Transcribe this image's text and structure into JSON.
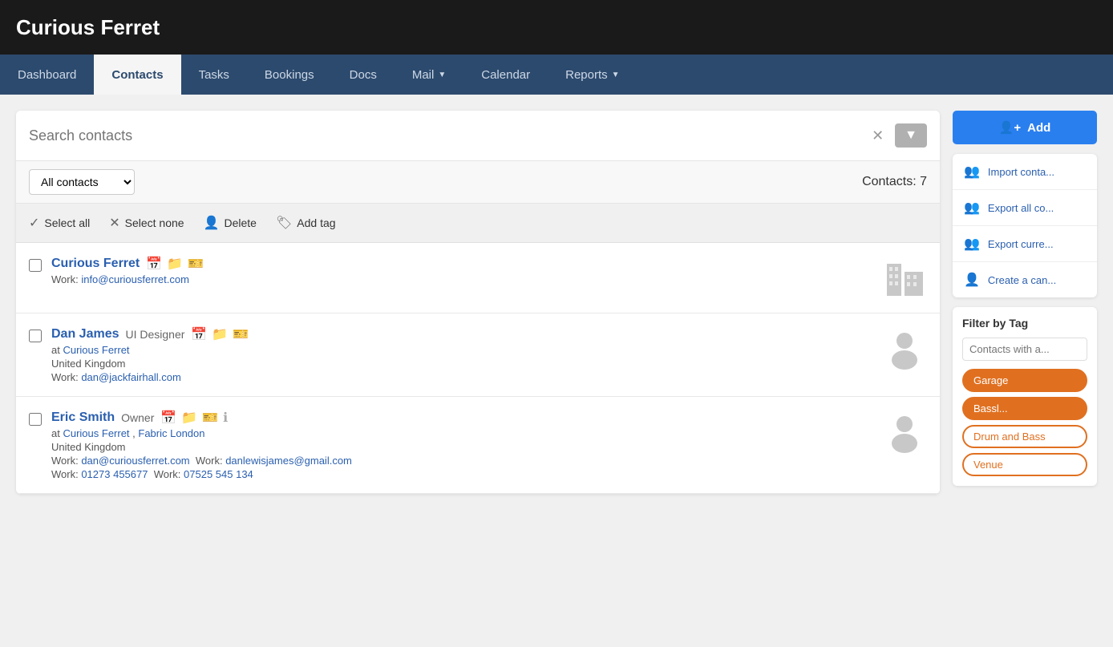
{
  "app": {
    "title": "Curious Ferret"
  },
  "nav": {
    "items": [
      {
        "id": "dashboard",
        "label": "Dashboard",
        "active": false,
        "dropdown": false
      },
      {
        "id": "contacts",
        "label": "Contacts",
        "active": true,
        "dropdown": false
      },
      {
        "id": "tasks",
        "label": "Tasks",
        "active": false,
        "dropdown": false
      },
      {
        "id": "bookings",
        "label": "Bookings",
        "active": false,
        "dropdown": false
      },
      {
        "id": "docs",
        "label": "Docs",
        "active": false,
        "dropdown": false
      },
      {
        "id": "mail",
        "label": "Mail",
        "active": false,
        "dropdown": true
      },
      {
        "id": "calendar",
        "label": "Calendar",
        "active": false,
        "dropdown": false
      },
      {
        "id": "reports",
        "label": "Reports",
        "active": false,
        "dropdown": true
      }
    ]
  },
  "search": {
    "placeholder": "Search contacts",
    "value": ""
  },
  "contacts": {
    "filter_label": "All contacts",
    "count_label": "Contacts: 7",
    "actions": {
      "select_all": "Select all",
      "select_none": "Select none",
      "delete": "Delete",
      "add_tag": "Add tag"
    },
    "items": [
      {
        "id": "curious-ferret-org",
        "name": "Curious Ferret",
        "role": "",
        "type": "organization",
        "at_company": "",
        "country": "",
        "work_email": "info@curiousferret.com",
        "work_email2": "",
        "work_email3": "",
        "work_phone": "",
        "work_phone2": ""
      },
      {
        "id": "dan-james",
        "name": "Dan James",
        "role": "UI Designer",
        "type": "person",
        "at_company": "Curious Ferret",
        "country": "United Kingdom",
        "work_email": "dan@jackfairhall.com",
        "work_email2": "",
        "work_email3": "",
        "work_phone": "",
        "work_phone2": ""
      },
      {
        "id": "eric-smith",
        "name": "Eric Smith",
        "role": "Owner",
        "type": "person",
        "at_company": "Curious Ferret",
        "at_company2": "Fabric London",
        "country": "United Kingdom",
        "work_email": "dan@curiousferret.com",
        "work_email2": "danlewisjames@gmail.com",
        "work_phone": "01273 455677",
        "work_phone2": "07525 545 134"
      }
    ]
  },
  "sidebar": {
    "add_button": "Add",
    "actions": [
      {
        "id": "import-contacts",
        "label": "Import conta..."
      },
      {
        "id": "export-all",
        "label": "Export all co..."
      },
      {
        "id": "export-current",
        "label": "Export curre..."
      },
      {
        "id": "create-campaign",
        "label": "Create a can..."
      }
    ],
    "filter_by_tag": {
      "title": "Filter by Tag",
      "placeholder": "Contacts with a..."
    },
    "tags": [
      {
        "id": "garage",
        "label": "Garage",
        "style": "active"
      },
      {
        "id": "bassline",
        "label": "Bassl...",
        "style": "active"
      },
      {
        "id": "drum-and-bass",
        "label": "Drum and Bass",
        "style": "outline"
      },
      {
        "id": "venue",
        "label": "Venue",
        "style": "outline"
      }
    ]
  }
}
